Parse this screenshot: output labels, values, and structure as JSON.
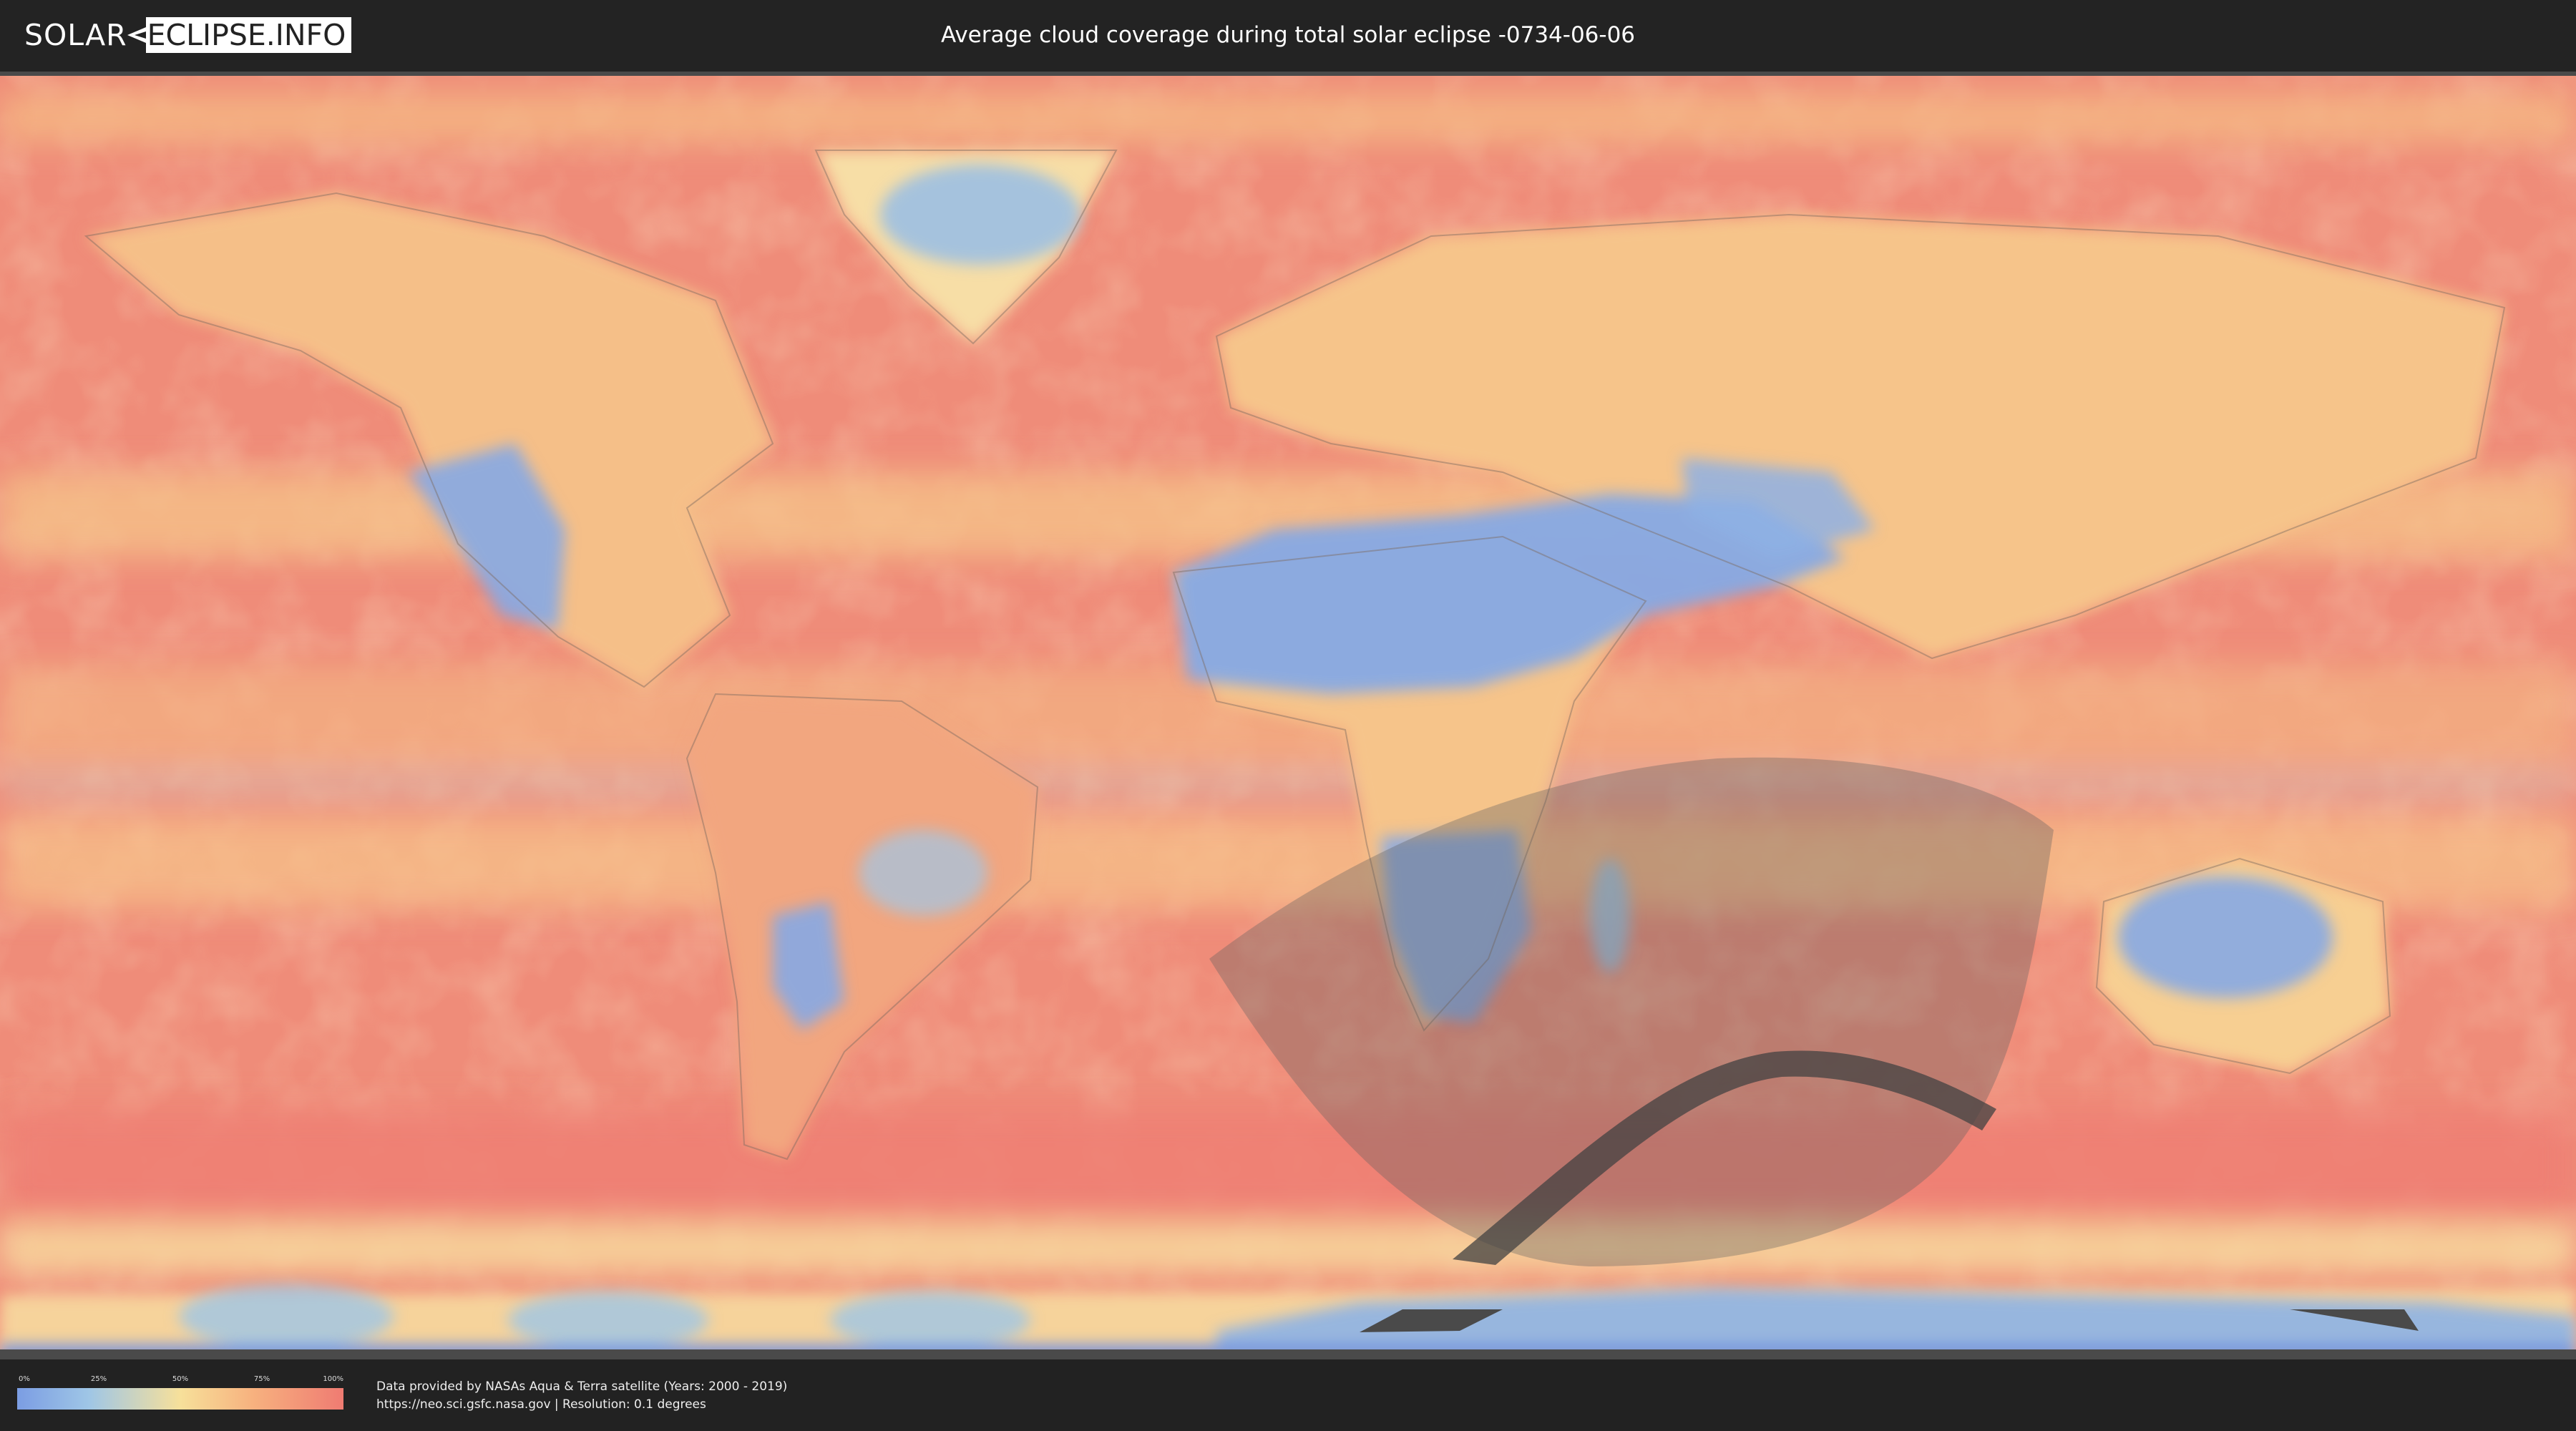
{
  "header": {
    "logo_part1": "SOLAR",
    "logo_part2": "ECLIPSE.INFO",
    "title": "Average cloud coverage during total solar eclipse -0734-06-06"
  },
  "legend": {
    "ticks": [
      "0%",
      "25%",
      "50%",
      "75%",
      "100%"
    ],
    "colors": [
      "#7b9de3",
      "#9fc6e6",
      "#f7e09a",
      "#f7b27f",
      "#ef7b72"
    ]
  },
  "credits": {
    "line1": "Data provided by NASAs Aqua & Terra satellite (Years: 2000 - 2019)",
    "line2": "https://neo.sci.gsfc.nasa.gov | Resolution: 0.1 degrees"
  },
  "map": {
    "colors": {
      "ocean_cloudy": "#ee8a78",
      "mid": "#f6c48a",
      "clear": "#86a9e4",
      "penumbra": "rgba(90,90,90,0.35)",
      "umbra": "rgba(60,60,60,0.75)"
    }
  }
}
